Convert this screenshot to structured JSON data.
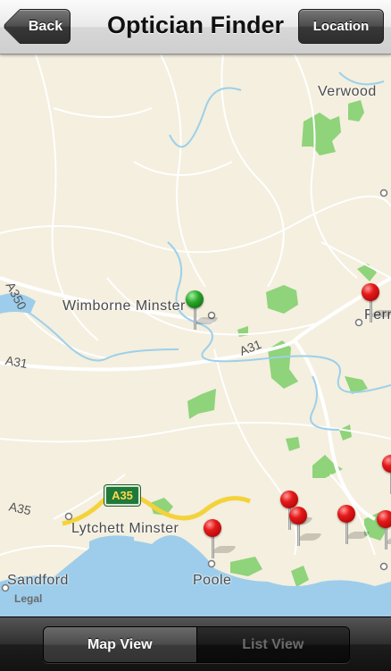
{
  "nav": {
    "title": "Optician Finder",
    "back_label": "Back",
    "location_label": "Location"
  },
  "map": {
    "places": {
      "verwood": "Verwood",
      "wimborne": "Wimborne Minster",
      "ferndown": "Fern",
      "lytchett": "Lytchett Minster",
      "sandford": "Sandford",
      "poole": "Poole"
    },
    "roads": {
      "a31_left": "A31",
      "a31_mid": "A31",
      "a35_left": "A35",
      "a35_shield": "A35",
      "a350": "A350"
    },
    "legal": "Legal",
    "pins": {
      "current_location_color": "#2aa62a",
      "optician_color": "#e51a1a",
      "optician_count": 8
    }
  },
  "toolbar": {
    "map_view_label": "Map View",
    "list_view_label": "List View",
    "selected": "Map View"
  }
}
